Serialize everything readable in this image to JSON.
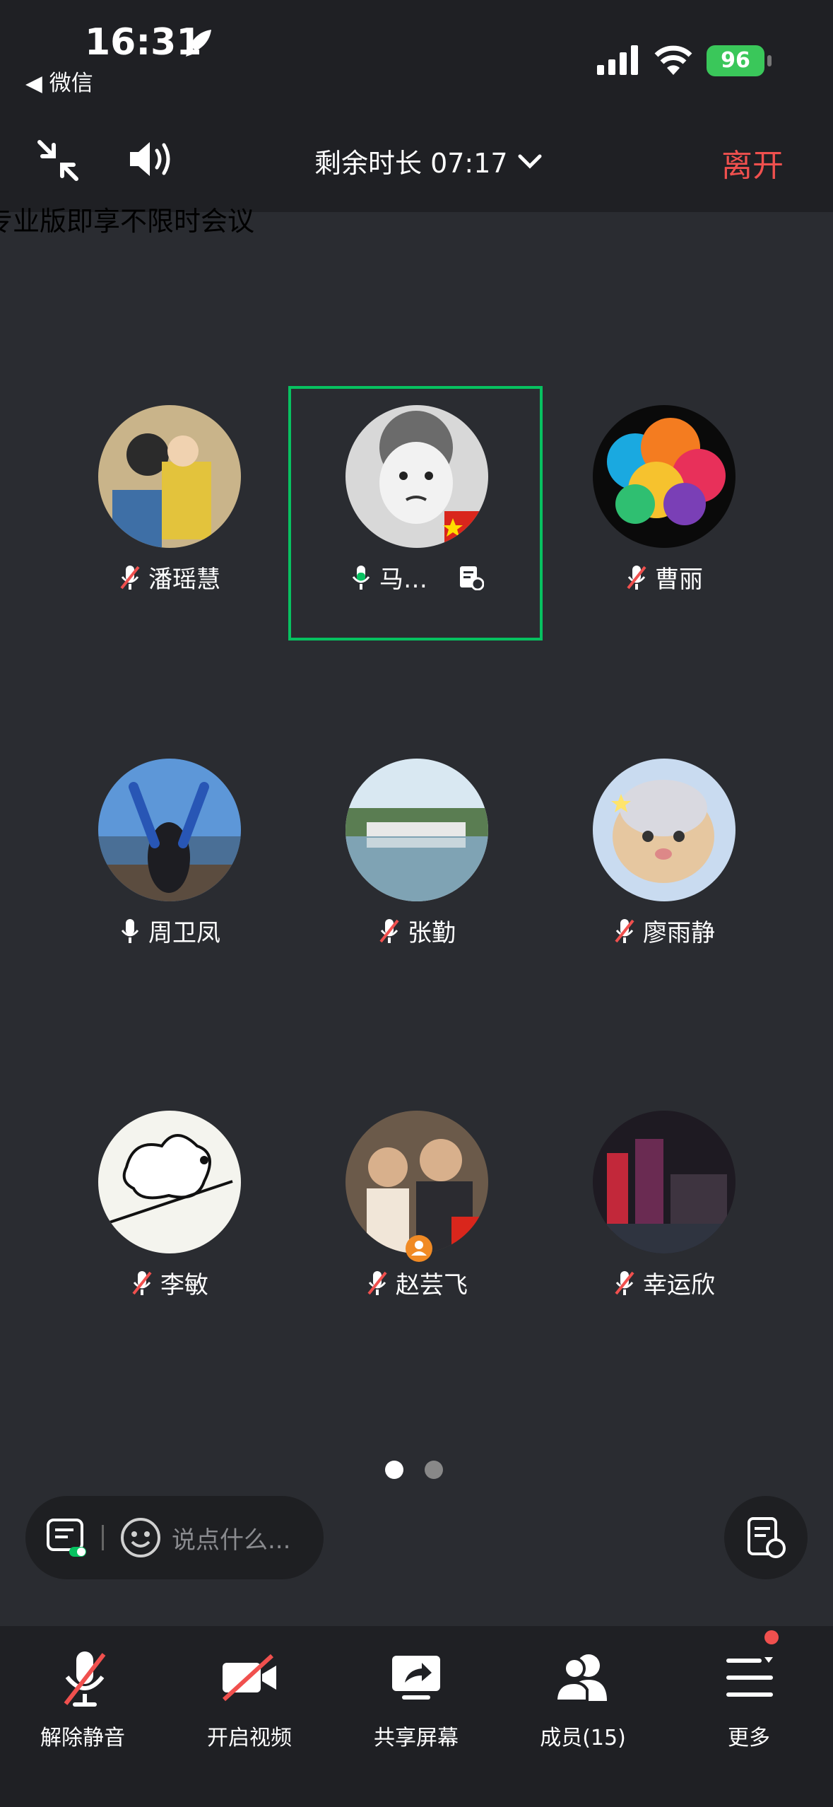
{
  "status_bar": {
    "time": "16:31",
    "back_app": "◀ 微信",
    "battery": "96"
  },
  "meeting_bar": {
    "timer": "剩余时长 07:17",
    "leave": "离开",
    "behind_text": "专业版即享不限时会议"
  },
  "participants": [
    {
      "name": "潘瑶慧",
      "mic": "muted"
    },
    {
      "name": "马…",
      "mic": "on"
    },
    {
      "name": "曹丽",
      "mic": "muted"
    },
    {
      "name": "周卫凤",
      "mic": "on"
    },
    {
      "name": "张勤",
      "mic": "muted"
    },
    {
      "name": "廖雨静",
      "mic": "muted"
    },
    {
      "name": "李敏",
      "mic": "muted"
    },
    {
      "name": "赵芸飞",
      "mic": "muted"
    },
    {
      "name": "幸运欣",
      "mic": "muted"
    }
  ],
  "chat": {
    "placeholder": "说点什么..."
  },
  "toolbar": {
    "unmute": "解除静音",
    "video": "开启视频",
    "share": "共享屏幕",
    "members": "成员(15)",
    "more": "更多"
  },
  "colors": {
    "accent_green": "#07c160",
    "leave_red": "#f0504e",
    "battery_green": "#3ac75a"
  }
}
